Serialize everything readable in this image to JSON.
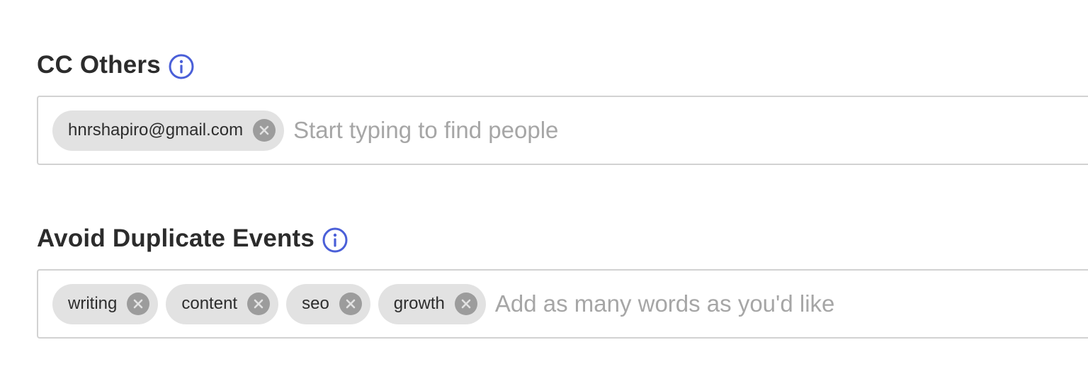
{
  "cc_others": {
    "label": "CC Others",
    "info_icon": "info-icon",
    "chips": [
      {
        "label": "hnrshapiro@gmail.com"
      }
    ],
    "input": {
      "value": "",
      "placeholder": "Start typing to find people"
    }
  },
  "avoid_duplicates": {
    "label": "Avoid Duplicate Events",
    "info_icon": "info-icon",
    "chips": [
      {
        "label": "writing"
      },
      {
        "label": "content"
      },
      {
        "label": "seo"
      },
      {
        "label": "growth"
      }
    ],
    "input": {
      "value": "",
      "placeholder": "Add as many words as you'd like"
    }
  },
  "colors": {
    "accent": "#4a5fd8",
    "chip_bg": "#e2e2e2",
    "chip_remove_bg": "#9c9c9c",
    "border": "#d2d2d2",
    "placeholder": "#a6a6a6",
    "label_text": "#2c2c2c"
  }
}
